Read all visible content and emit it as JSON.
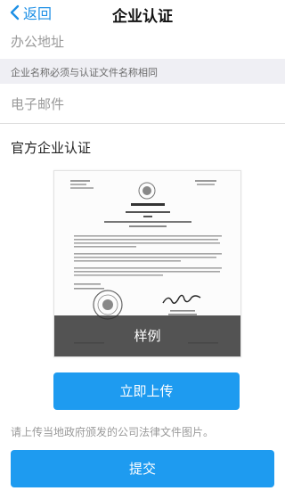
{
  "header": {
    "back_label": "返回",
    "title": "企业认证"
  },
  "form": {
    "address_placeholder": "办公地址",
    "note": "企业名称必须与认证文件名称相同",
    "email_placeholder": "电子邮件"
  },
  "certification": {
    "section_title": "官方企业认证",
    "sample_label": "样例",
    "upload_label": "立即上传",
    "hint": "请上传当地政府颁发的公司法律文件图片。"
  },
  "footer": {
    "submit_label": "提交"
  },
  "colors": {
    "accent": "#1e9bf0",
    "back": "#1e90e6",
    "band": "#efeff4"
  }
}
